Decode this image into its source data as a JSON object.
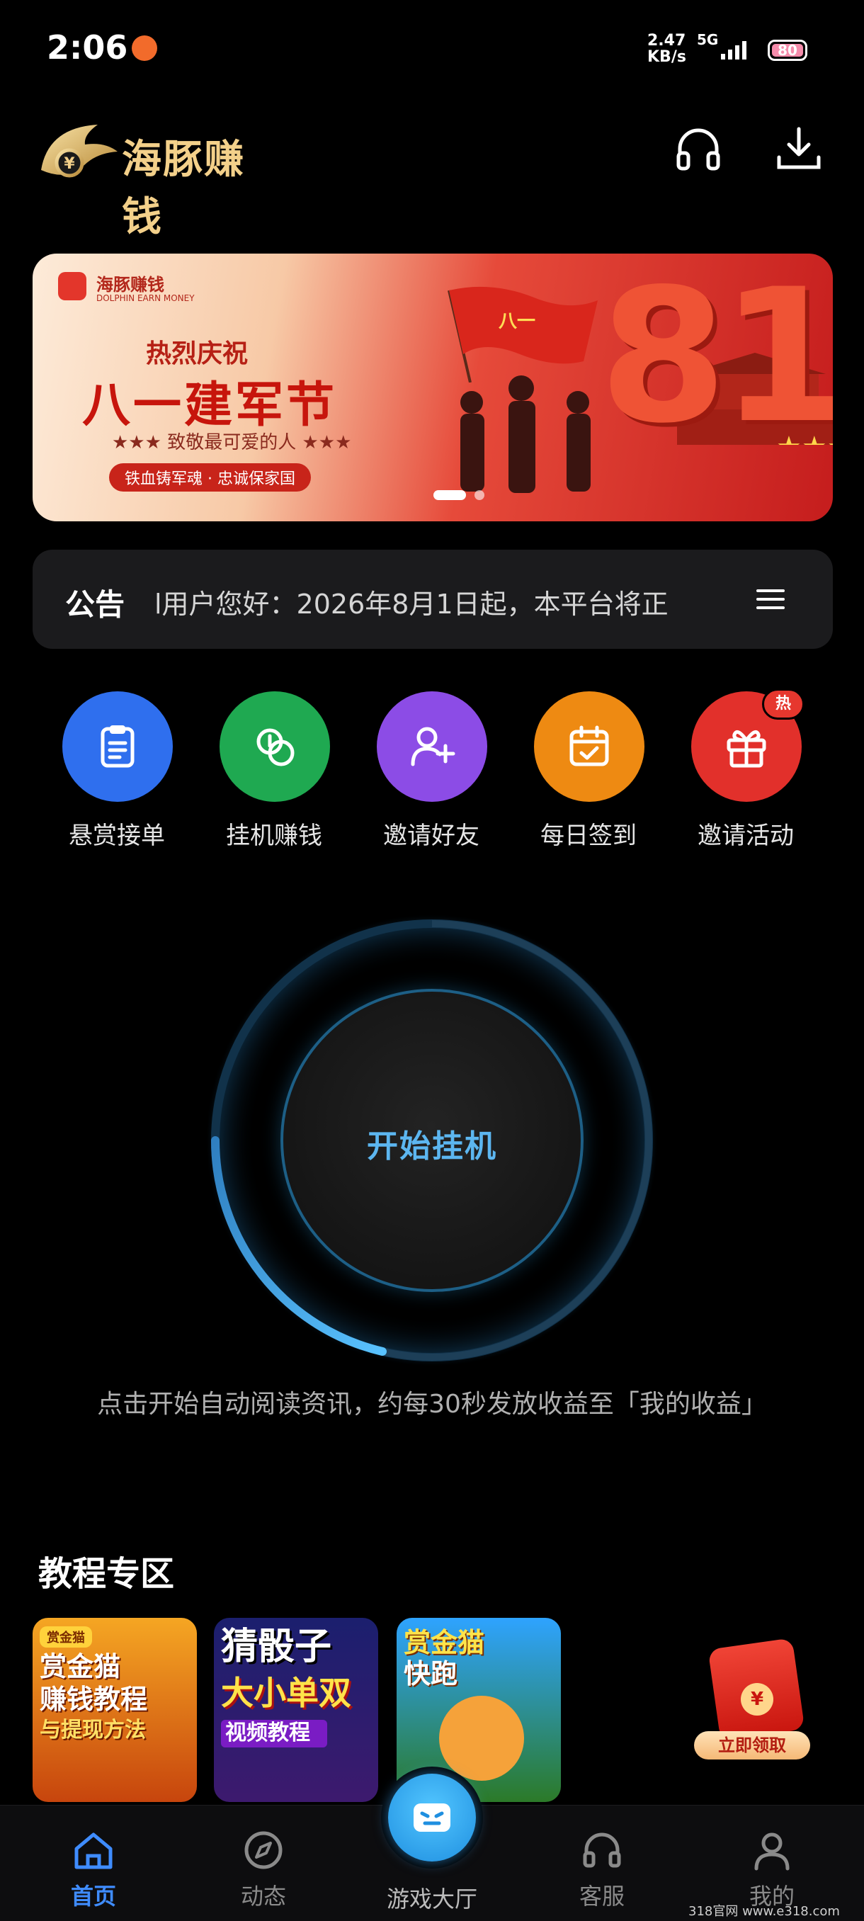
{
  "status_bar": {
    "time": "2:06",
    "net_speed": "2.47\nKB/s",
    "network": "5G",
    "battery": "80"
  },
  "header": {
    "logo_text": "海豚赚钱"
  },
  "banner": {
    "brand": "海豚赚钱",
    "brand_sub": "DOLPHIN EARN MONEY",
    "kicker": "热烈庆祝",
    "headline": "八一建军节",
    "sub": "★★★ 致敬最可爱的人 ★★★",
    "pill": "铁血铸军魂 · 忠诚保家国",
    "big_number": "81",
    "flag_text": "八一",
    "slide_count": 2,
    "active_slide": 1
  },
  "notice": {
    "label": "公告",
    "text": "l用户您好：2026年8月1日起，本平台将正"
  },
  "quick_actions": [
    {
      "label": "悬赏接单",
      "icon": "clipboard-icon",
      "color": "#2f6fee"
    },
    {
      "label": "挂机赚钱",
      "icon": "coins-icon",
      "color": "#1fa951"
    },
    {
      "label": "邀请好友",
      "icon": "add-user-icon",
      "color": "#8c4ce6"
    },
    {
      "label": "每日签到",
      "icon": "calendar-check-icon",
      "color": "#ee8a12"
    },
    {
      "label": "邀请活动",
      "icon": "gift-icon",
      "color": "#e2302b",
      "badge": "热"
    }
  ],
  "start": {
    "label": "开始挂机",
    "hint": "点击开始自动阅读资讯，约每30秒发放收益至「我的收益」"
  },
  "tutorials": {
    "title": "教程专区",
    "items": [
      {
        "tag": "赏金猫",
        "line1": "赏金猫",
        "line2": "赚钱教程",
        "line3": "与提现方法"
      },
      {
        "tag": "",
        "line1": "猜骰子",
        "line2": "大小单双",
        "line3": "视频教程"
      },
      {
        "tag": "",
        "line1": "赏金猫",
        "line2": "快跑",
        "line3": ""
      }
    ]
  },
  "red_packet": {
    "label": "立即领取",
    "coin": "¥"
  },
  "bottom_nav": {
    "items": [
      {
        "label": "首页",
        "icon": "home-icon",
        "active": true
      },
      {
        "label": "动态",
        "icon": "compass-icon",
        "active": false
      },
      {
        "label": "游戏大厅",
        "icon": "game-icon",
        "active": false
      },
      {
        "label": "客服",
        "icon": "headset-icon",
        "active": false
      },
      {
        "label": "我的",
        "icon": "profile-icon",
        "active": false
      }
    ]
  },
  "watermark": "318官网 www.e318.com",
  "colors": {
    "accent": "#3f8cff",
    "ring": "#3aa3e8",
    "background": "#000000"
  }
}
